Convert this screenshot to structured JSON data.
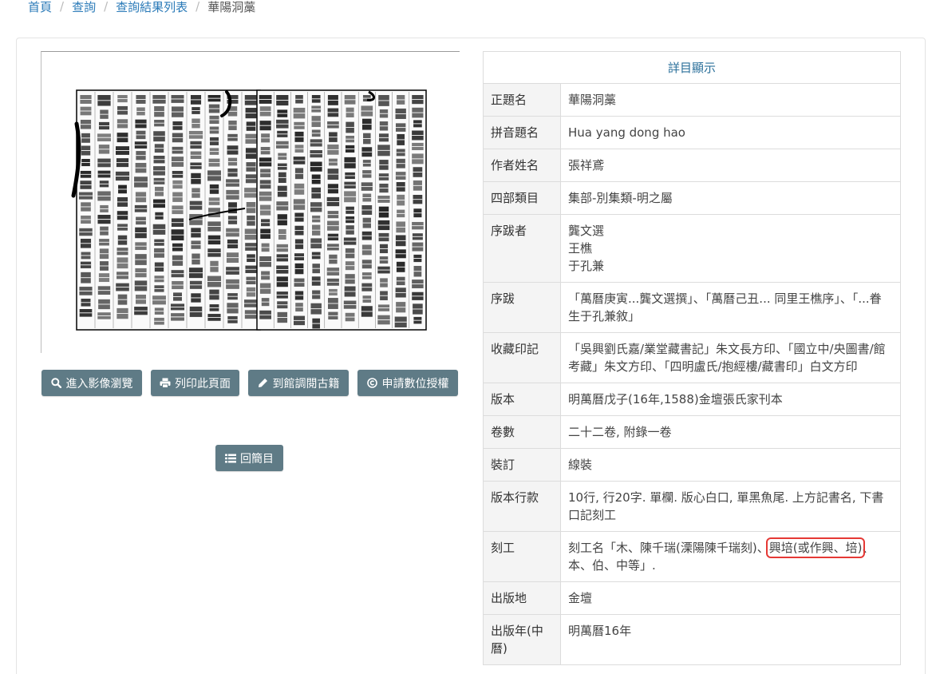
{
  "breadcrumb": {
    "home": "首頁",
    "query": "查詢",
    "results": "查詢結果列表",
    "current": "華陽洞藁"
  },
  "buttons": {
    "view_image": "進入影像瀏覽",
    "print_page": "列印此頁面",
    "library_access": "到館調閱古籍",
    "apply_license": "申請數位授權",
    "back_to_list": "回簡目"
  },
  "icons": {
    "view_image": "search-icon",
    "print_page": "print-icon",
    "library_access": "pencil-icon",
    "apply_license": "copyright-icon",
    "back_to_list": "list-icon"
  },
  "detail": {
    "header": "詳目顯示",
    "rows": [
      {
        "label": "正題名",
        "value": "華陽洞藁"
      },
      {
        "label": "拼音題名",
        "value": "Hua yang dong hao"
      },
      {
        "label": "作者姓名",
        "value": "張祥鳶"
      },
      {
        "label": "四部類目",
        "value": "集部-別集類-明之屬"
      },
      {
        "label": "序跋者",
        "value": [
          "龔文選",
          "王樵",
          "于孔兼"
        ]
      },
      {
        "label": "序跋",
        "value": "「萬曆庚寅...龔文選撰」、「萬曆己丑... 同里王樵序」、「...眷生于孔兼敘」"
      },
      {
        "label": "收藏印記",
        "value": "「吳興劉氏嘉/業堂藏書記」朱文長方印、「國立中/央圖書/館考藏」朱文方印、「四明盧氏/抱經樓/藏書印」白文方印"
      },
      {
        "label": "版本",
        "value": "明萬曆戊子(16年,1588)金壇張氏家刊本"
      },
      {
        "label": "卷數",
        "value": "二十二卷, 附錄一卷"
      },
      {
        "label": "裝訂",
        "value": "線裝"
      },
      {
        "label": "版本行款",
        "value": "10行, 行20字. 單欄. 版心白口, 單黑魚尾. 上方記書名, 下書口記刻工"
      },
      {
        "label": "刻工",
        "value_before": "刻工名「木、陳千瑞(溧陽陳千瑞刻)、",
        "value_highlight": "興培(或作興、培)",
        "value_after": "、本、伯、中等」."
      },
      {
        "label": "出版地",
        "value": "金壇"
      },
      {
        "label": "出版年(中曆)",
        "value": "明萬曆16年"
      }
    ]
  },
  "colors": {
    "button_bg": "#5f7b86",
    "link": "#2a7ab8",
    "highlight_box": "#e53935"
  }
}
